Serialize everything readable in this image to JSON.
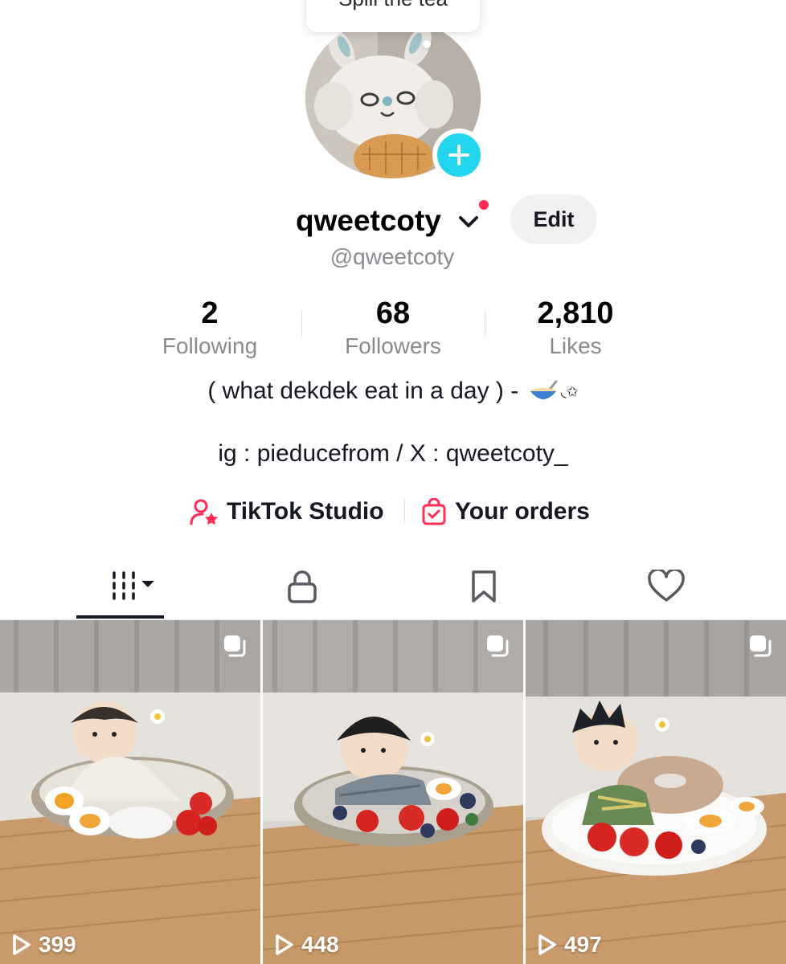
{
  "tooltip": {
    "text": "Spill the tea"
  },
  "profile": {
    "display_name": "qweetcoty",
    "username": "@qweetcoty",
    "edit_label": "Edit"
  },
  "stats": [
    {
      "value": "2",
      "label": "Following"
    },
    {
      "value": "68",
      "label": "Followers"
    },
    {
      "value": "2,810",
      "label": "Likes"
    }
  ],
  "bio": {
    "line1_text": "( what dekdek eat in a day ) - ",
    "line1_tail": "◟✩",
    "line2": "ig : pieducefrom / X : qweetcoty_"
  },
  "links": {
    "studio_label": "TikTok Studio",
    "orders_label": "Your orders"
  },
  "tabs": [
    "videos-grid",
    "private",
    "saved",
    "liked"
  ],
  "videos": [
    {
      "views": "399"
    },
    {
      "views": "448"
    },
    {
      "views": "497"
    }
  ],
  "colors": {
    "accent_red": "#fe2c55",
    "badge_cyan": "#20d5ec",
    "text_primary": "#161823",
    "text_secondary": "#8a8b91"
  }
}
